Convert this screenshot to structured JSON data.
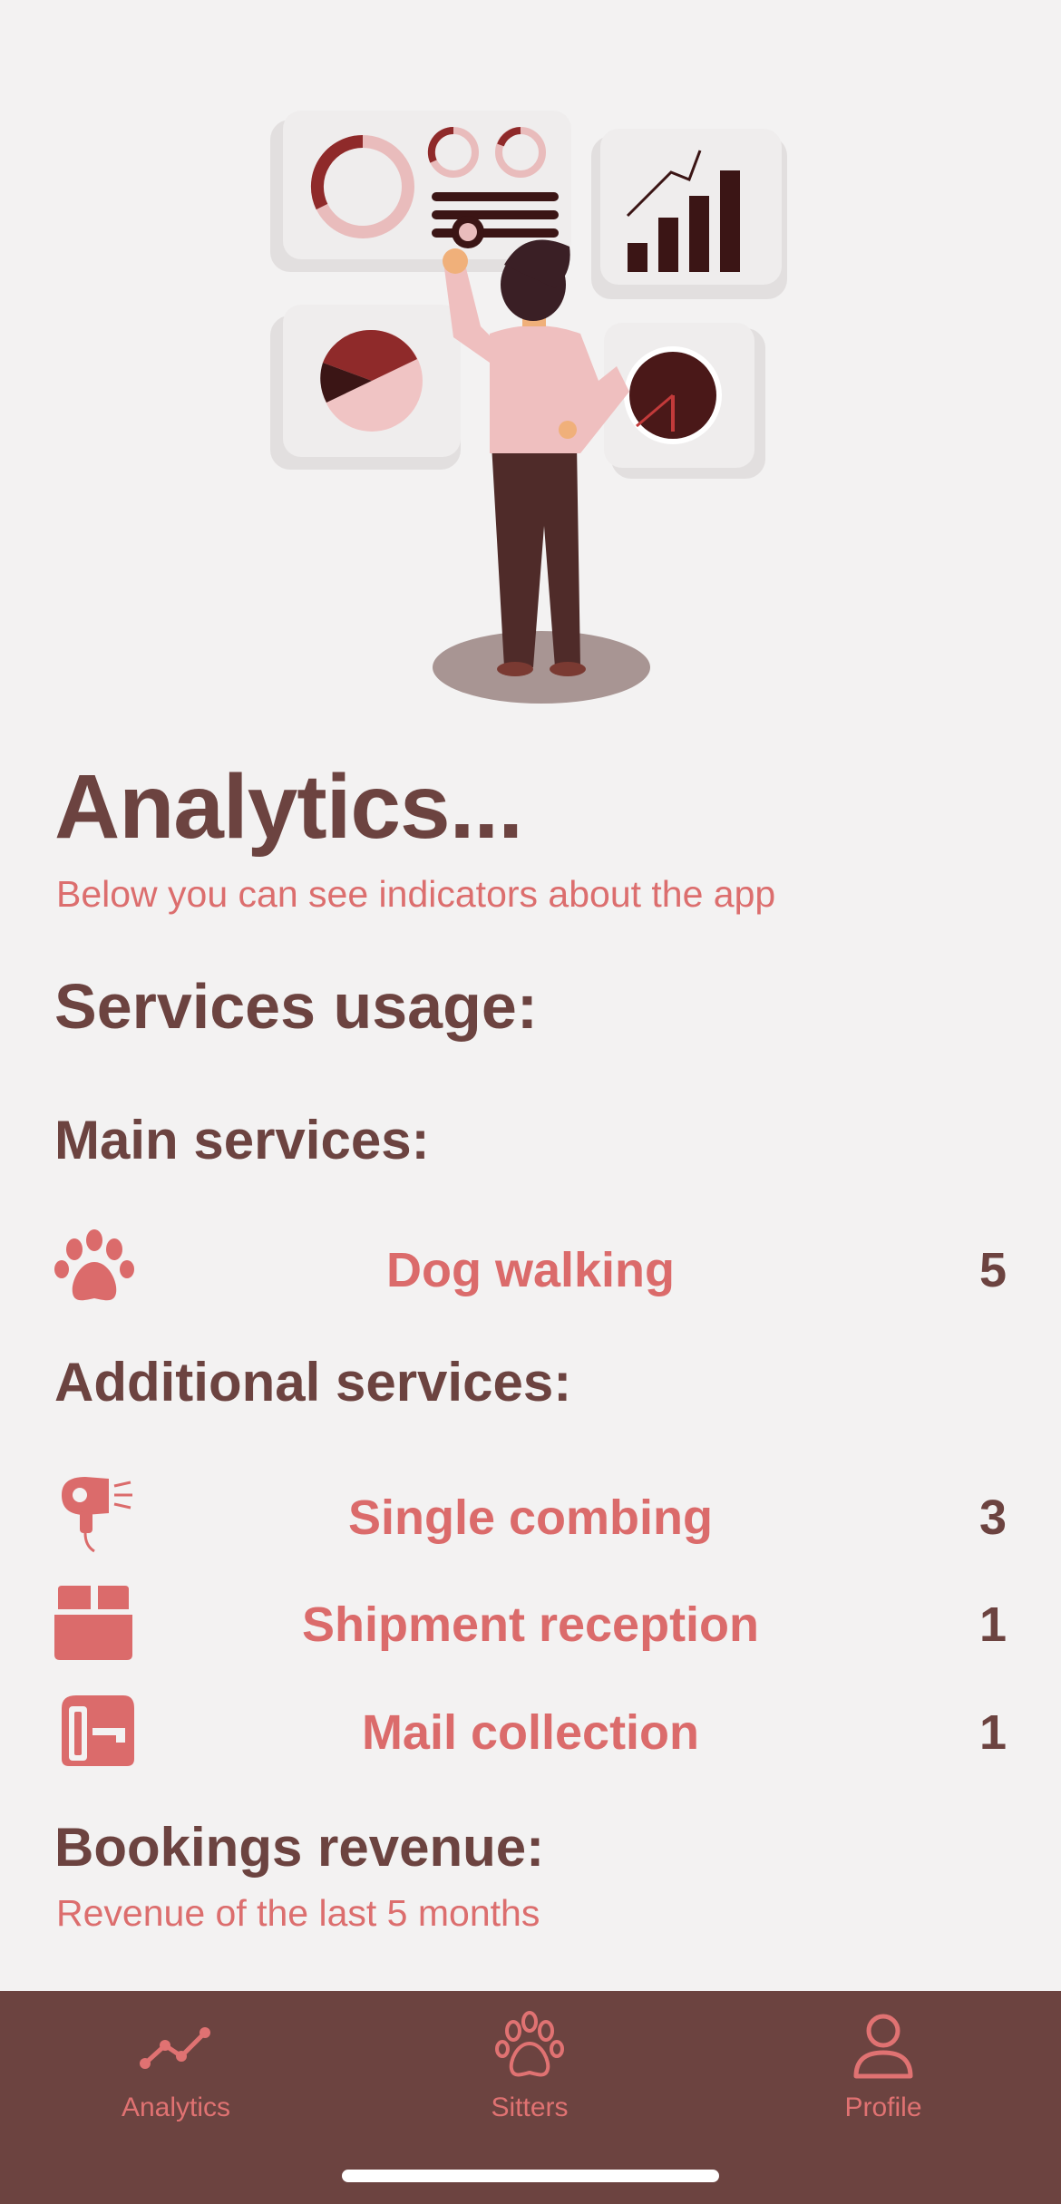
{
  "header": {
    "title": "Analytics...",
    "subtitle": "Below you can see indicators about the app"
  },
  "services": {
    "heading": "Services usage:",
    "main": {
      "heading": "Main services:",
      "items": [
        {
          "label": "Dog walking",
          "count": "5",
          "icon": "paw-icon"
        }
      ]
    },
    "additional": {
      "heading": "Additional services:",
      "items": [
        {
          "label": "Single combing",
          "count": "3",
          "icon": "hair-dryer-icon"
        },
        {
          "label": "Shipment reception",
          "count": "1",
          "icon": "package-icon"
        },
        {
          "label": "Mail collection",
          "count": "1",
          "icon": "mailbox-icon"
        }
      ]
    }
  },
  "revenue": {
    "heading": "Bookings revenue:",
    "subtitle": "Revenue of the last 5 months"
  },
  "tabbar": {
    "items": [
      {
        "label": "Analytics",
        "icon": "line-chart-icon"
      },
      {
        "label": "Sitters",
        "icon": "paw-icon"
      },
      {
        "label": "Profile",
        "icon": "person-icon"
      }
    ]
  },
  "colors": {
    "background": "#f3f2f2",
    "primary_dark": "#6c4340",
    "accent": "#db6b6b"
  }
}
